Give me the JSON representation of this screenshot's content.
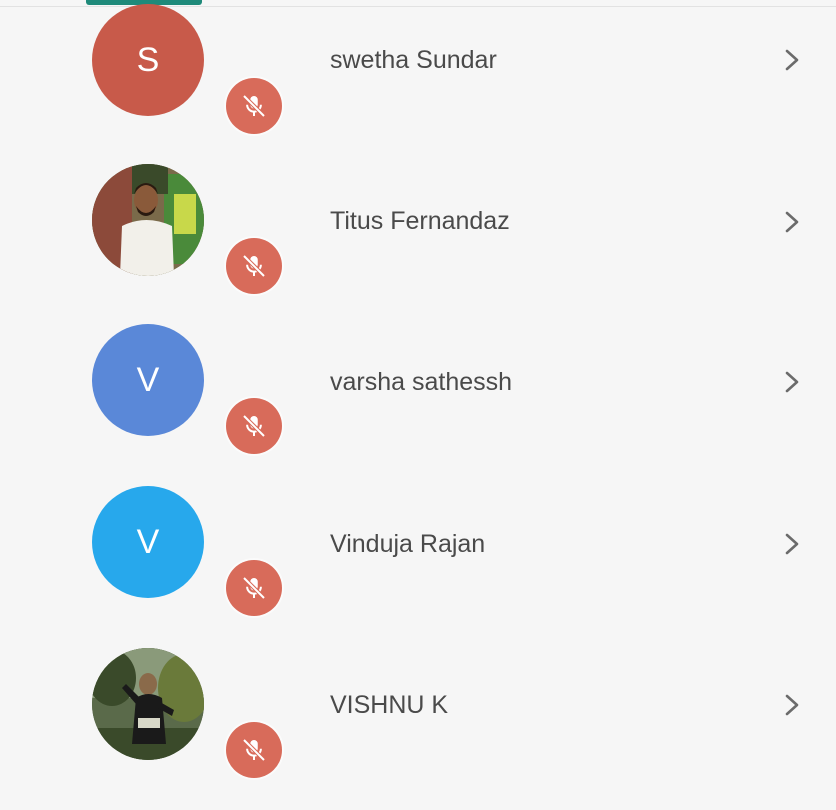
{
  "participants": [
    {
      "name": "swetha Sundar",
      "avatar": {
        "type": "initial",
        "initial": "S",
        "color": "#c85a4a"
      },
      "muted": true
    },
    {
      "name": "Titus Fernandaz",
      "avatar": {
        "type": "photo",
        "initial": ""
      },
      "muted": true
    },
    {
      "name": "varsha sathessh",
      "avatar": {
        "type": "initial",
        "initial": "V",
        "color": "#5a88d8"
      },
      "muted": true
    },
    {
      "name": "Vinduja Rajan",
      "avatar": {
        "type": "initial",
        "initial": "V",
        "color": "#27a8ec"
      },
      "muted": true
    },
    {
      "name": "VISHNU K",
      "avatar": {
        "type": "photo",
        "initial": ""
      },
      "muted": true
    }
  ],
  "colors": {
    "mute_badge": "#d86b5a",
    "name_text": "#4a4a4a",
    "chevron": "#6b6b6b",
    "tab_indicator": "#1f8a7a",
    "background": "#f6f6f6"
  },
  "icons": {
    "mute": "mic-off-icon",
    "chevron": "chevron-right-icon"
  }
}
